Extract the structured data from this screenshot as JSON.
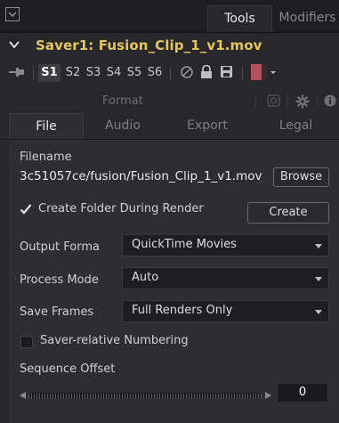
{
  "top_tabs": {
    "tools": "Tools",
    "modifiers": "Modifiers"
  },
  "node": {
    "title": "Saver1: Fusion_Clip_1_v1.mov"
  },
  "versions": [
    "S1",
    "S2",
    "S3",
    "S4",
    "S5",
    "S6"
  ],
  "active_version": "S1",
  "section": {
    "label": "Format"
  },
  "sub_tabs": [
    "File",
    "Audio",
    "Export",
    "Legal"
  ],
  "active_sub_tab": "File",
  "file": {
    "filename_label": "Filename",
    "filename_value": "3c51057ce/fusion/Fusion_Clip_1_v1.mov",
    "browse_label": "Browse",
    "create_folder_label": "Create Folder During Render",
    "create_folder_checked": true,
    "create_label": "Create",
    "output_format_label": "Output Forma",
    "output_format_value": "QuickTime Movies",
    "process_mode_label": "Process Mode",
    "process_mode_value": "Auto",
    "save_frames_label": "Save Frames",
    "save_frames_value": "Full Renders Only",
    "saver_relative_label": "Saver-relative Numbering",
    "saver_relative_checked": false,
    "sequence_offset_label": "Sequence Offset",
    "sequence_offset_value": "0"
  },
  "colors": {
    "accent_title": "#e5c65a",
    "swatch": "#b74f5e",
    "panel_bg": "#28282b"
  },
  "icons": [
    "layout-icon",
    "chevron-down-icon",
    "pin-icon",
    "disable-icon",
    "lock-icon",
    "save-icon",
    "color-swatch",
    "camera-icon",
    "gear-icon",
    "info-icon"
  ]
}
